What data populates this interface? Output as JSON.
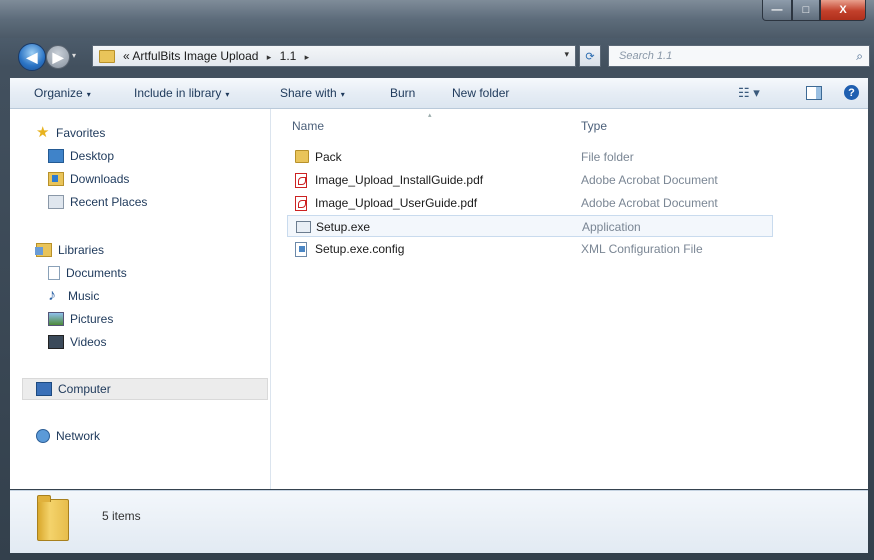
{
  "window": {
    "caption_buttons": {
      "minimize": "—",
      "maximize": "□",
      "close": "X"
    }
  },
  "nav": {
    "back_glyph": "◀",
    "forward_glyph": "▶"
  },
  "address": {
    "prefix": "«",
    "crumbs": [
      "ArtfulBits Image Upload",
      "1.1"
    ],
    "separator": "▸",
    "dropdown_glyph": "▾"
  },
  "search": {
    "placeholder": "Search 1.1",
    "icon": "search-icon"
  },
  "toolbar": {
    "organize": "Organize",
    "include_in_library": "Include in library",
    "share_with": "Share with",
    "burn": "Burn",
    "new_folder": "New folder",
    "caret": "▾",
    "view_glyph": "☷ ▾",
    "help_glyph": "?"
  },
  "sidebar": {
    "favorites": "Favorites",
    "favorites_items": [
      "Desktop",
      "Downloads",
      "Recent Places"
    ],
    "libraries": "Libraries",
    "libraries_items": [
      "Documents",
      "Music",
      "Pictures",
      "Videos"
    ],
    "computer": "Computer",
    "network": "Network"
  },
  "columns": {
    "name": "Name",
    "type": "Type"
  },
  "files": [
    {
      "name": "Pack",
      "type": "File folder",
      "icon": "folder-icon"
    },
    {
      "name": "Image_Upload_InstallGuide.pdf",
      "type": "Adobe Acrobat Document",
      "icon": "pdf-icon"
    },
    {
      "name": "Image_Upload_UserGuide.pdf",
      "type": "Adobe Acrobat Document",
      "icon": "pdf-icon"
    },
    {
      "name": "Setup.exe",
      "type": "Application",
      "icon": "exe-icon",
      "selected": true
    },
    {
      "name": "Setup.exe.config",
      "type": "XML Configuration File",
      "icon": "config-icon"
    }
  ],
  "details": {
    "count": "5 items"
  }
}
